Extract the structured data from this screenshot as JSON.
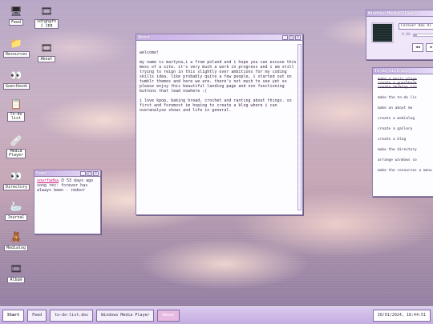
{
  "desktop": {
    "icons": [
      {
        "id": "feed",
        "label": "Feed",
        "glyph": "🖥"
      },
      {
        "id": "asdfgh",
        "label": "sdfghgfh\nj jpg",
        "glyph": "🎞"
      },
      {
        "id": "resources",
        "label": "Resources",
        "glyph": "📁"
      },
      {
        "id": "about",
        "label": "About",
        "glyph": "🎞"
      },
      {
        "id": "guestbook",
        "label": "Guestbook",
        "glyph": "👀"
      },
      {
        "id": "todo",
        "label": "To-do\nlist",
        "glyph": "📋"
      },
      {
        "id": "media-player",
        "label": "Media\nPlayer",
        "glyph": "🩹"
      },
      {
        "id": "directory",
        "label": "Directory",
        "glyph": "👀"
      },
      {
        "id": "journal",
        "label": "Journal",
        "glyph": "🦢"
      },
      {
        "id": "medialog",
        "label": "Medialog",
        "glyph": "🧸"
      },
      {
        "id": "album",
        "label": "Album",
        "glyph": "🎞"
      }
    ]
  },
  "about_window": {
    "title": "About",
    "heading": "welcome!",
    "paragraph1": "my name is martyna,i a from poland and i hope you can excuse this mess of a site. it's very much a work in progress and i am still trying to reign in this slightly over ambitions for my coding skills idea. like probably quite a few people, i started out on tumblr themes and here we are. there's not much to see yet so please enjoy this beautiful landing page and non functioning buttons that lead nowhere :(",
    "paragraph2": "i love kpop, baking bread, crochet and ranting about things. so first and foremost im hoping to create a blog where i can overanalyse shows and life in general."
  },
  "feed_window": {
    "title": "Feed",
    "username": "sourfadka",
    "time_icon": "⏱",
    "time": "53 days ago",
    "post": "song rec: forever has always been - redoor"
  },
  "media_window": {
    "title": "Windows Media Player",
    "track": "Forever Has Al",
    "time": "0:00",
    "progress": 0.12,
    "controls": [
      "◀◀",
      "▶"
    ]
  },
  "todo_window": {
    "title": "To-do list.doc",
    "items": [
      {
        "text": "make a music playe",
        "done": true
      },
      {
        "text": "create a guestbook",
        "done": true
      },
      {
        "text": "create desktop ico",
        "done": true
      },
      {
        "text": "make the to-do lis",
        "done": false
      },
      {
        "text": "make an about me",
        "done": false
      },
      {
        "text": "create a medialog",
        "done": false
      },
      {
        "text": "create a gallery",
        "done": false
      },
      {
        "text": "create a blog",
        "done": false
      },
      {
        "text": "make the directory",
        "done": false
      },
      {
        "text": "arrange windows co",
        "done": false
      },
      {
        "text": "make the resources a menu",
        "done": false
      }
    ]
  },
  "taskbar": {
    "start": "Start",
    "items": [
      "Feed",
      "to-do-list.doc",
      "Windows Media Player",
      "About"
    ],
    "active": "About",
    "clock": "30/01/2024, 18:44:51"
  },
  "colors": {
    "accent": "#c6aee6",
    "link": "#d0177a",
    "active_task": "#e7b8e1"
  }
}
